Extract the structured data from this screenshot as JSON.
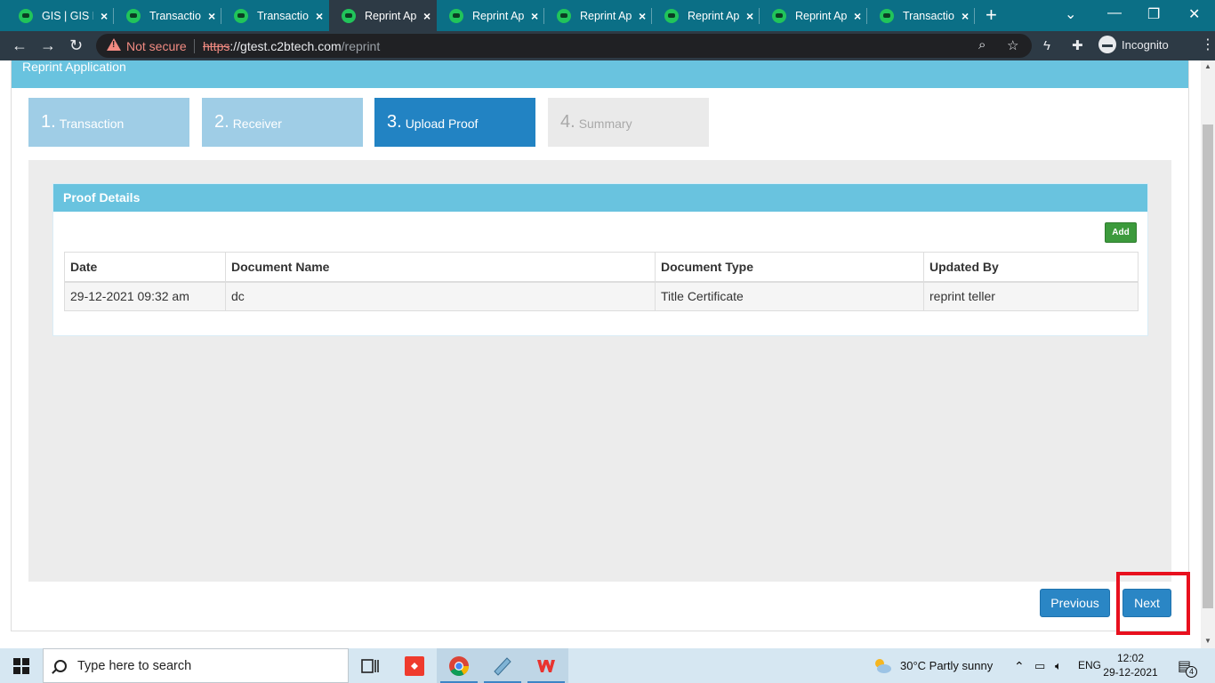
{
  "browser": {
    "tabs": [
      {
        "title": "GIS | GIS Portal"
      },
      {
        "title": "Transaction"
      },
      {
        "title": "Transaction"
      },
      {
        "title": "Reprint Application"
      },
      {
        "title": "Reprint Application"
      },
      {
        "title": "Reprint Application"
      },
      {
        "title": "Reprint Application"
      },
      {
        "title": "Reprint Application"
      },
      {
        "title": "Transaction"
      }
    ],
    "active_tab_index": 3,
    "security_label": "Not secure",
    "url_scheme": "https",
    "url_separator": "://",
    "url_host": "gtest.c2btech.com",
    "url_path": "/reprint",
    "incognito_label": "Incognito"
  },
  "page": {
    "panel_title": "Reprint Application",
    "steps": [
      {
        "number": "1.",
        "label": "Transaction",
        "state": "done"
      },
      {
        "number": "2.",
        "label": "Receiver",
        "state": "done"
      },
      {
        "number": "3.",
        "label": "Upload Proof",
        "state": "current"
      },
      {
        "number": "4.",
        "label": "Summary",
        "state": "pending"
      }
    ],
    "proof_card": {
      "title": "Proof Details",
      "add_label": "Add",
      "columns": [
        "Date",
        "Document Name",
        "Document Type",
        "Updated By"
      ],
      "rows": [
        [
          "29-12-2021 09:32 am",
          "dc",
          "Title Certificate",
          "reprint teller"
        ]
      ]
    },
    "previous_label": "Previous",
    "next_label": "Next"
  },
  "taskbar": {
    "search_placeholder": "Type here to search",
    "weather": "30°C  Partly sunny",
    "language": "ENG",
    "time": "12:02",
    "date": "29-12-2021",
    "notification_count": "4"
  },
  "colors": {
    "accent_header": "#69c3df",
    "step_current": "#2283c3",
    "button_primary": "#2a86c5",
    "add_button": "#3c9a3c",
    "highlight": "#e8101e"
  }
}
